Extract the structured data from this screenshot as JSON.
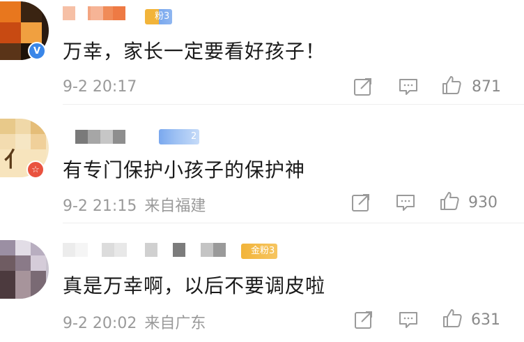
{
  "comments": [
    {
      "text": "万幸，家长一定要看好孩子！",
      "time": "9-2 20:17",
      "location": "",
      "likes": "871",
      "fan_label": "粉3",
      "badge_glyph": "V",
      "badge_color": "#3a86e8"
    },
    {
      "text": "有专门保护小孩子的保护神",
      "time": "9-2 21:15",
      "location": "来自福建",
      "likes": "930",
      "fan_label": "2",
      "badge_glyph": "☆",
      "badge_color": "#e9523f"
    },
    {
      "text": "真是万幸啊，以后不要调皮啦",
      "time": "9-2 20:02",
      "location": "来自广东",
      "likes": "631",
      "fan_label": "金粉3",
      "badge_glyph": "",
      "badge_color": ""
    }
  ],
  "icons": {
    "share": "share-icon",
    "reply": "comment-icon",
    "like": "thumbs-up-icon"
  },
  "colors": {
    "text": "#1a1a1a",
    "meta": "#9a9a9a",
    "fan_gold": "#f2b43a",
    "fan_blue": "#7aa8ee"
  }
}
